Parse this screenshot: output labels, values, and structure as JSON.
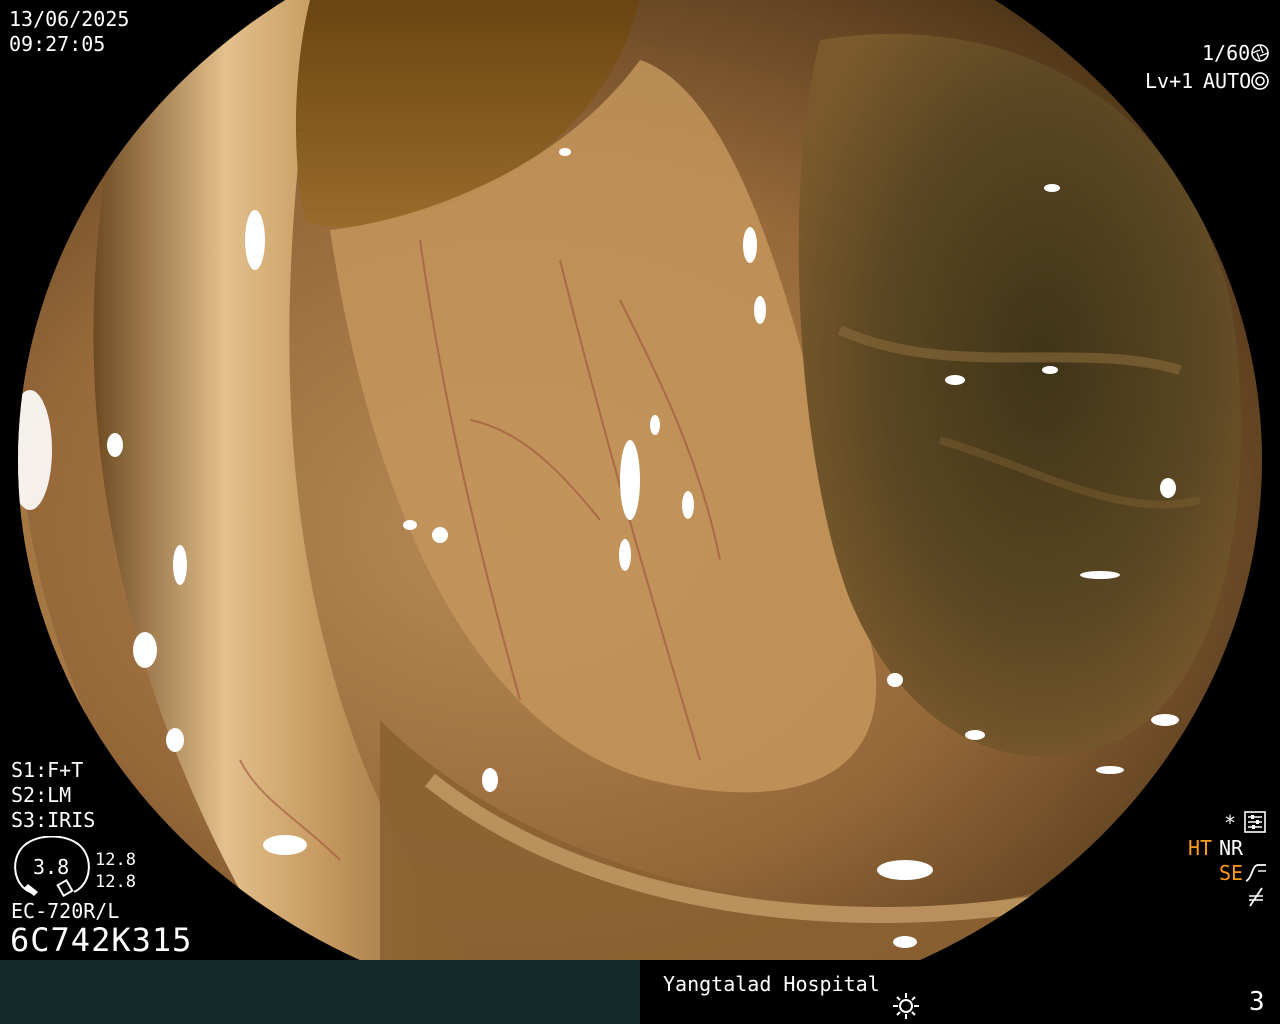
{
  "overlay": {
    "date": "13/06/2025",
    "time": "09:27:05",
    "shutter": "1/60",
    "level": "Lv+1",
    "mode": "AUTO",
    "s1": "S1:F+T",
    "s2": "S2:LM",
    "s3": "S3:IRIS",
    "gauge_value": "3.8",
    "gauge_top": "12.8",
    "gauge_bottom": "12.8",
    "model": "EC-720R/L",
    "serial": "6C742K315",
    "asterisk": "*",
    "ht": "HT",
    "nr": "NR",
    "se": "SE"
  },
  "footer": {
    "hospital": "Yangtalad Hospital",
    "page": "3"
  },
  "icons": [
    "aperture-icon",
    "iris-icon",
    "settings-icon",
    "curve-icon",
    "enhance-icon",
    "light-icon"
  ],
  "colors": {
    "accent": "#ff9a1a",
    "footer_bg": "#142a2b",
    "overlay_text": "#ffffff"
  }
}
